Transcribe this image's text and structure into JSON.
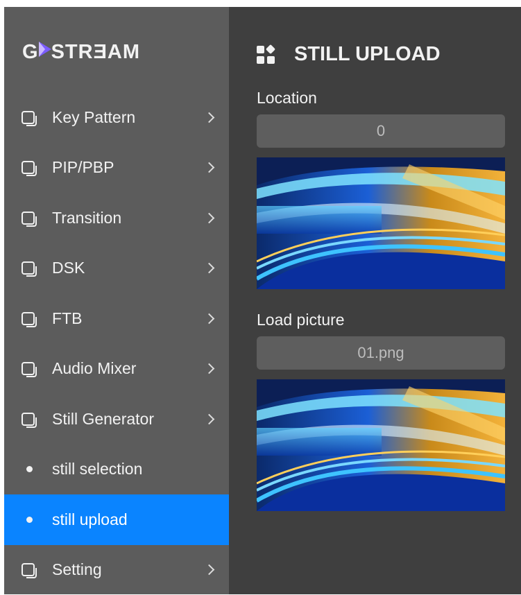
{
  "brand": {
    "logo_text_left": "G",
    "logo_text_right": "STRƎAM"
  },
  "sidebar": {
    "items": [
      {
        "label": "Key Pattern",
        "type": "group"
      },
      {
        "label": "PIP/PBP",
        "type": "group"
      },
      {
        "label": "Transition",
        "type": "group"
      },
      {
        "label": "DSK",
        "type": "group"
      },
      {
        "label": "FTB",
        "type": "group"
      },
      {
        "label": "Audio Mixer",
        "type": "group"
      },
      {
        "label": "Still Generator",
        "type": "group"
      },
      {
        "label": "still selection",
        "type": "sub"
      },
      {
        "label": "still upload",
        "type": "sub",
        "active": true
      },
      {
        "label": "Setting",
        "type": "group"
      }
    ]
  },
  "main": {
    "title": "STILL UPLOAD",
    "location": {
      "label": "Location",
      "value": "0"
    },
    "load": {
      "label": "Load picture",
      "value": "01.png"
    }
  },
  "colors": {
    "accent": "#0a84ff",
    "sidebar_bg": "#5c5c5c",
    "main_bg": "#3f3f3f"
  }
}
